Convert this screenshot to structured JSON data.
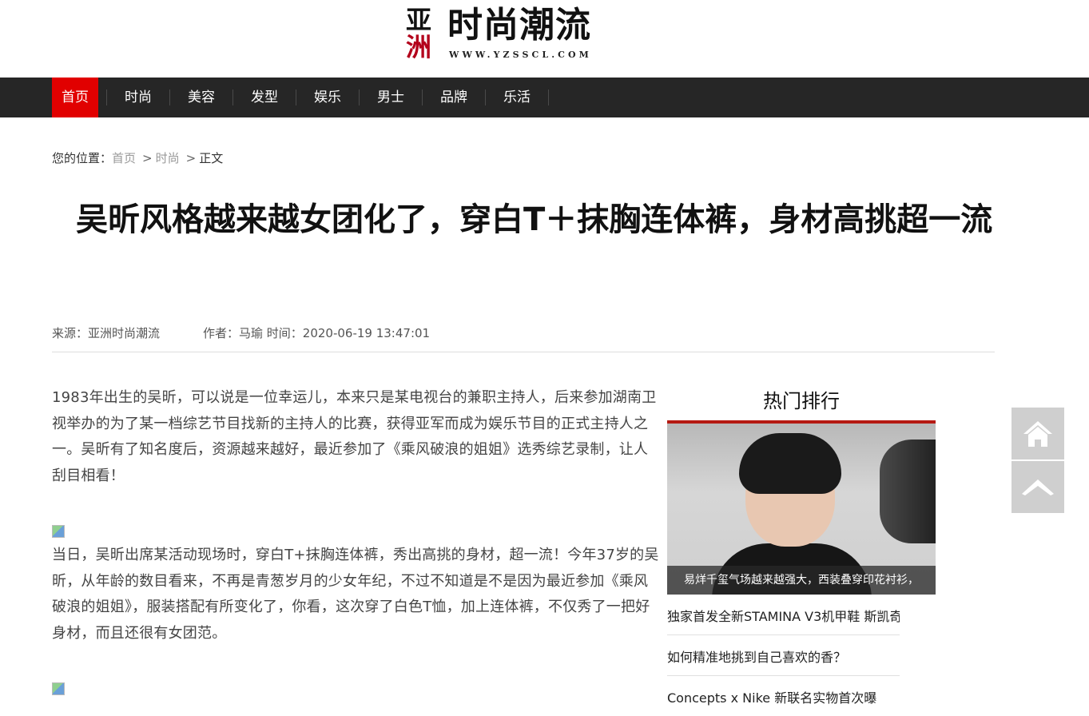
{
  "logo": {
    "mark_top": "亚",
    "mark_bottom": "洲",
    "title": "时尚潮流",
    "url": "WWW.YZSSCL.COM"
  },
  "nav": {
    "items": [
      {
        "label": "首页",
        "active": true
      },
      {
        "label": "时尚",
        "active": false
      },
      {
        "label": "美容",
        "active": false
      },
      {
        "label": "发型",
        "active": false
      },
      {
        "label": "娱乐",
        "active": false
      },
      {
        "label": "男士",
        "active": false
      },
      {
        "label": "品牌",
        "active": false
      },
      {
        "label": "乐活",
        "active": false
      }
    ],
    "active_color": "#e10000",
    "bg_color": "#262626"
  },
  "breadcrumb": {
    "prefix": "您的位置：",
    "items": [
      "首页",
      "时尚"
    ],
    "separator": ">",
    "current": "正文"
  },
  "article": {
    "title": "吴昕风格越来越女团化了，穿白T＋抹胸连体裤，身材高挑超一流",
    "source": "来源：亚洲时尚潮流",
    "author_time": "作者：马瑜 时间：2020-06-19 13:47:01",
    "paragraphs": [
      "1983年出生的吴昕，可以说是一位幸运儿，本来只是某电视台的兼职主持人，后来参加湖南卫视举办的为了某一档综艺节目找新的主持人的比赛，获得亚军而成为娱乐节目的正式主持人之一。吴昕有了知名度后，资源越来越好，最近参加了《乘风破浪的姐姐》选秀综艺录制，让人刮目相看！",
      "当日，吴昕出席某活动现场时，穿白T+抹胸连体裤，秀出高挑的身材，超一流！今年37岁的吴昕，从年龄的数目看来，不再是青葱岁月的少女年纪，不过不知道是不是因为最近参加《乘风破浪的姐姐》，服装搭配有所变化了，你看，这次穿了白色T恤，加上连体裤，不仅秀了一把好身材，而且还很有女团范。"
    ]
  },
  "sidebar": {
    "title": "热门排行",
    "accent_color": "#b51a12",
    "feature_caption": "易烊千玺气场越来越强大，西装叠穿印花衬衫，",
    "list": [
      "独家首发全新STAMINA V3机甲鞋 斯凯奇",
      "如何精准地挑到自己喜欢的香？",
      "Concepts x Nike 新联名实物首次曝"
    ]
  },
  "float_buttons": {
    "home_icon": "home-icon",
    "top_icon": "chevron-up-icon"
  }
}
